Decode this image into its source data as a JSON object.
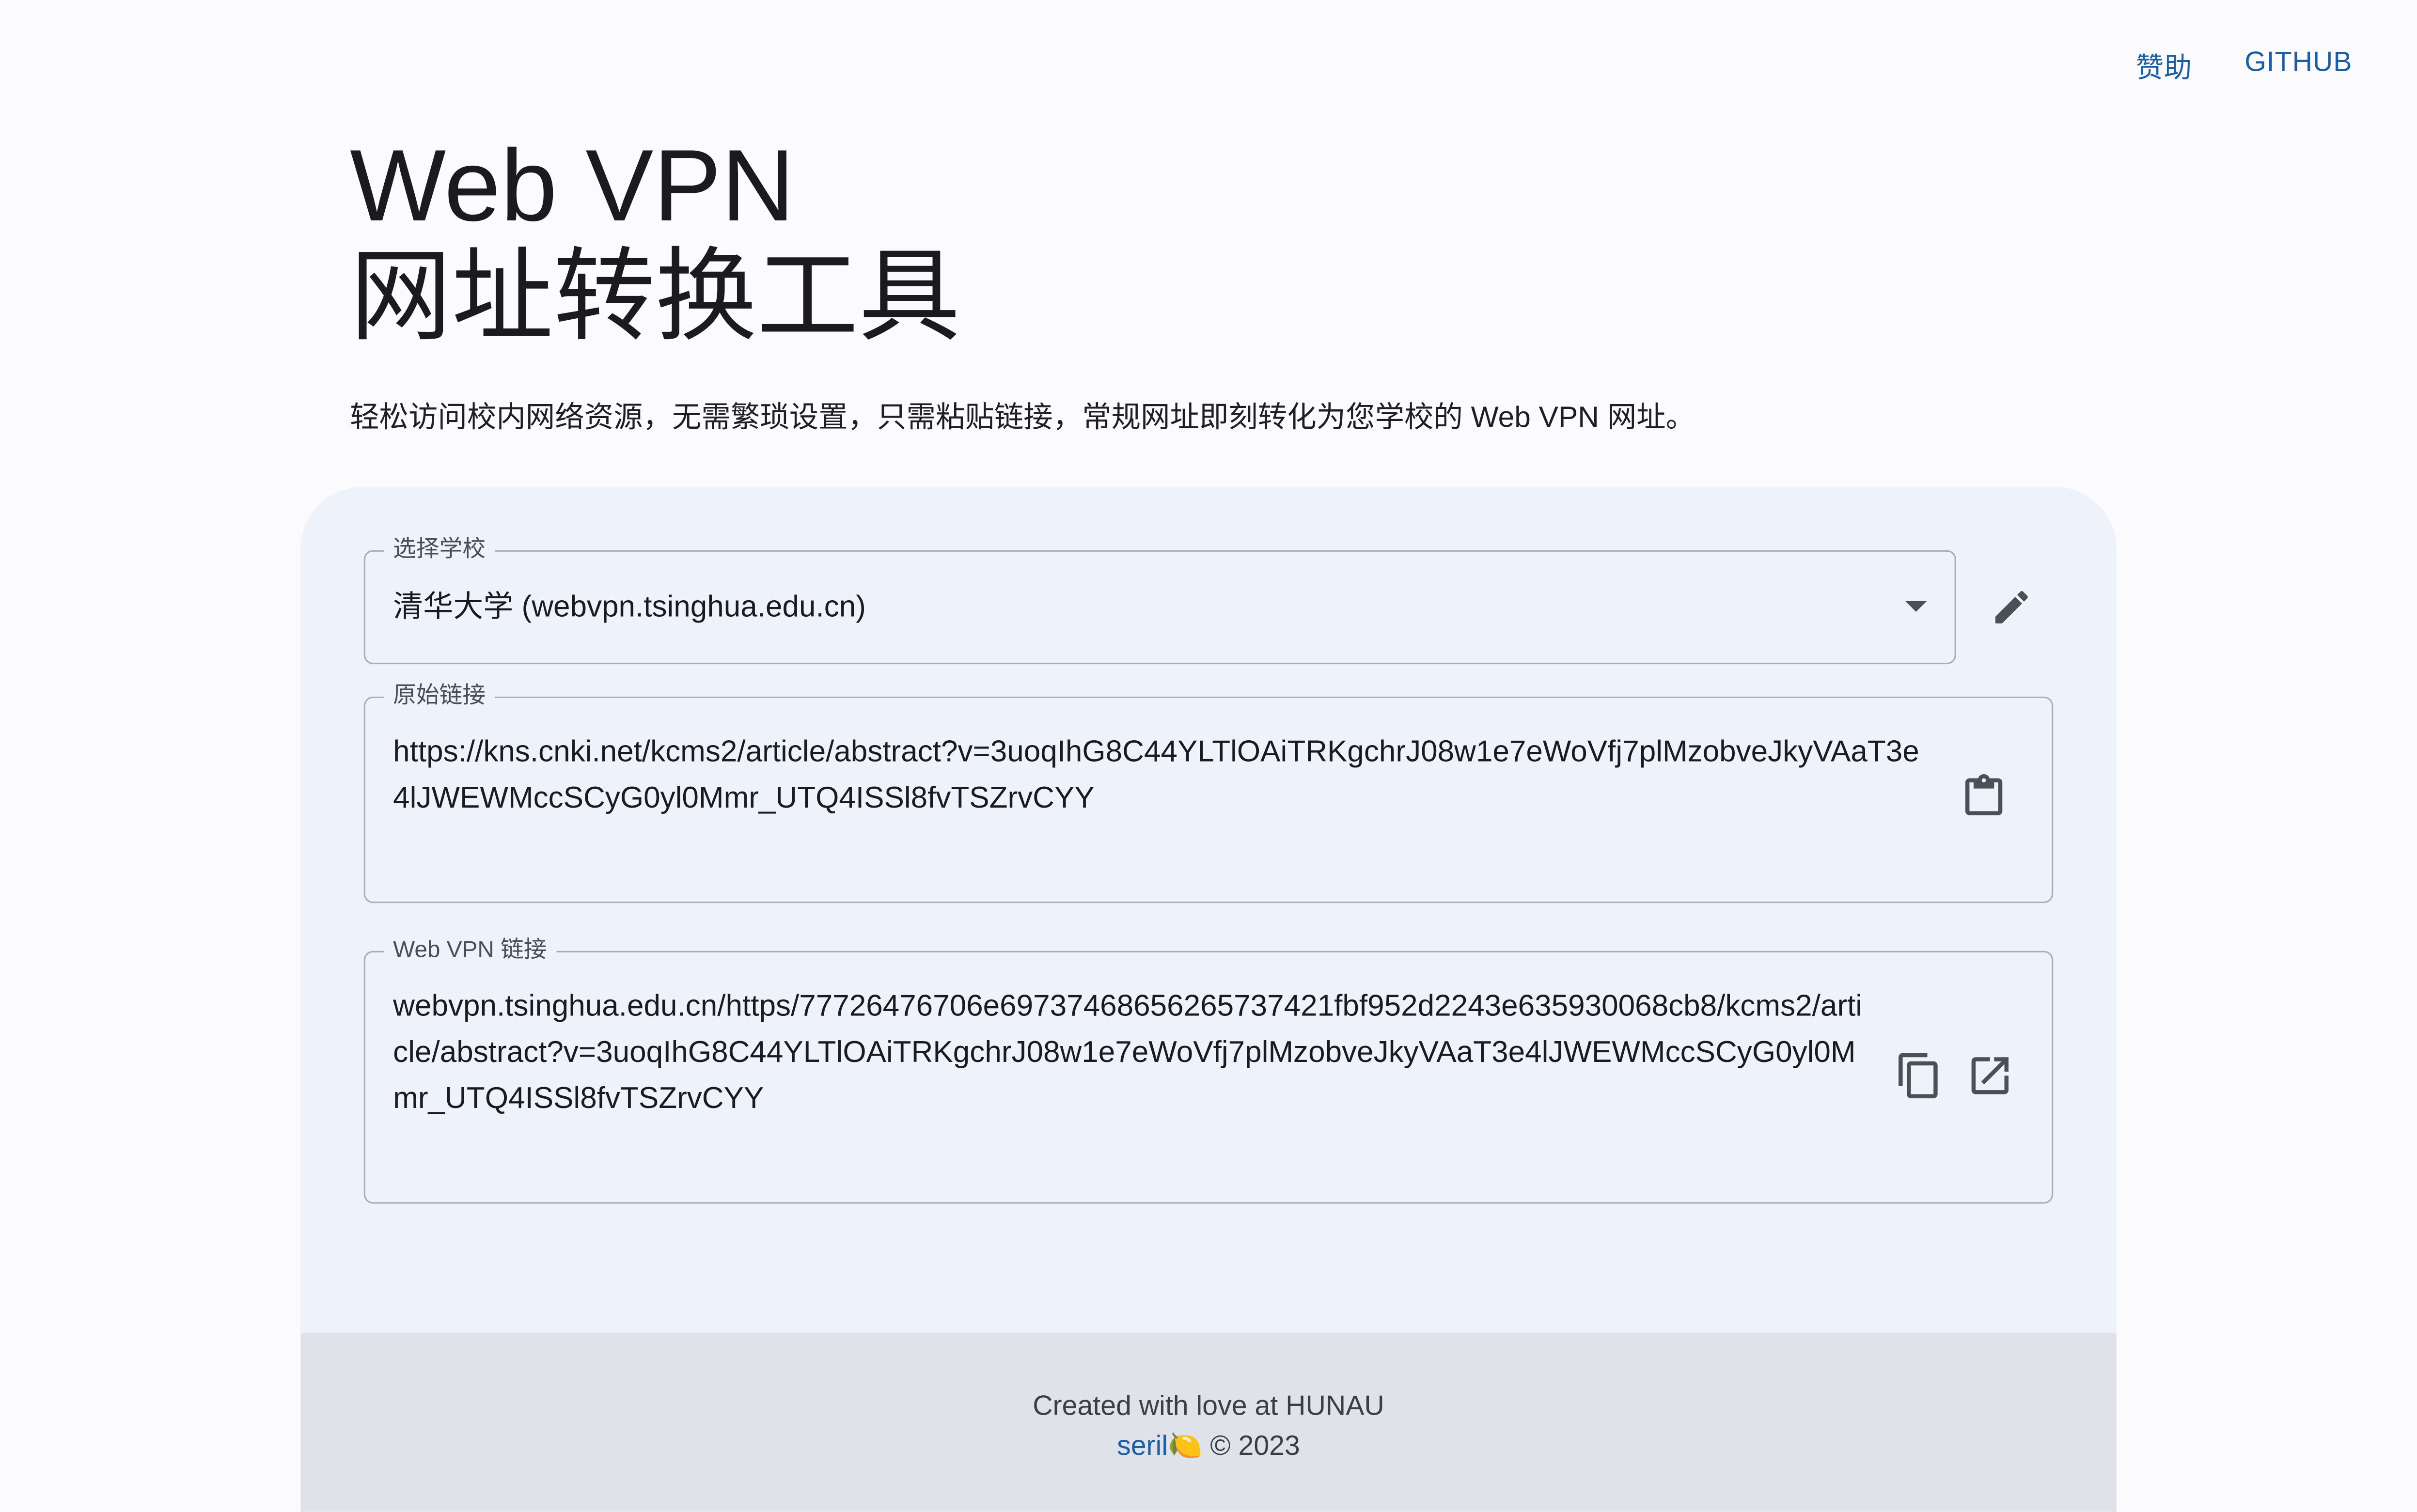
{
  "nav": {
    "sponsor": "赞助",
    "github": "GITHUB"
  },
  "hero": {
    "title_line1": "Web VPN",
    "title_line2": "网址转换工具",
    "subtitle": "轻松访问校内网络资源，无需繁琐设置，只需粘贴链接，常规网址即刻转化为您学校的 Web VPN 网址。"
  },
  "form": {
    "school": {
      "label": "选择学校",
      "value": "清华大学 (webvpn.tsinghua.edu.cn)"
    },
    "original": {
      "label": "原始链接",
      "value": "https://kns.cnki.net/kcms2/article/abstract?v=3uoqIhG8C44YLTlOAiTRKgchrJ08w1e7eWoVfj7plMzobveJkyVAaT3e4lJWEWMccSCyG0yl0Mmr_UTQ4ISSl8fvTSZrvCYY"
    },
    "webvpn": {
      "label": "Web VPN 链接",
      "value": "webvpn.tsinghua.edu.cn/https/77726476706e69737468656265737421fbf952d2243e635930068cb8/kcms2/article/abstract?v=3uoqIhG8C44YLTlOAiTRKgchrJ08w1e7eWoVfj7plMzobveJkyVAaT3e4lJWEWMccSCyG0yl0Mmr_UTQ4ISSl8fvTSZrvCYY"
    }
  },
  "icons": {
    "edit": "pencil-icon",
    "paste": "clipboard-icon",
    "copy": "copy-icon",
    "open": "open-in-new-icon",
    "dropdown": "chevron-down-icon"
  },
  "footer": {
    "line1": "Created with love at HUNAU",
    "author": "seril",
    "emoji": "🍋",
    "copyright": "© 2023"
  },
  "colors": {
    "accent": "#1a5fa6",
    "background": "#fbfbfe",
    "card": "#eef2fb",
    "footer": "#e0e2ea",
    "outline": "#a9aebb"
  }
}
